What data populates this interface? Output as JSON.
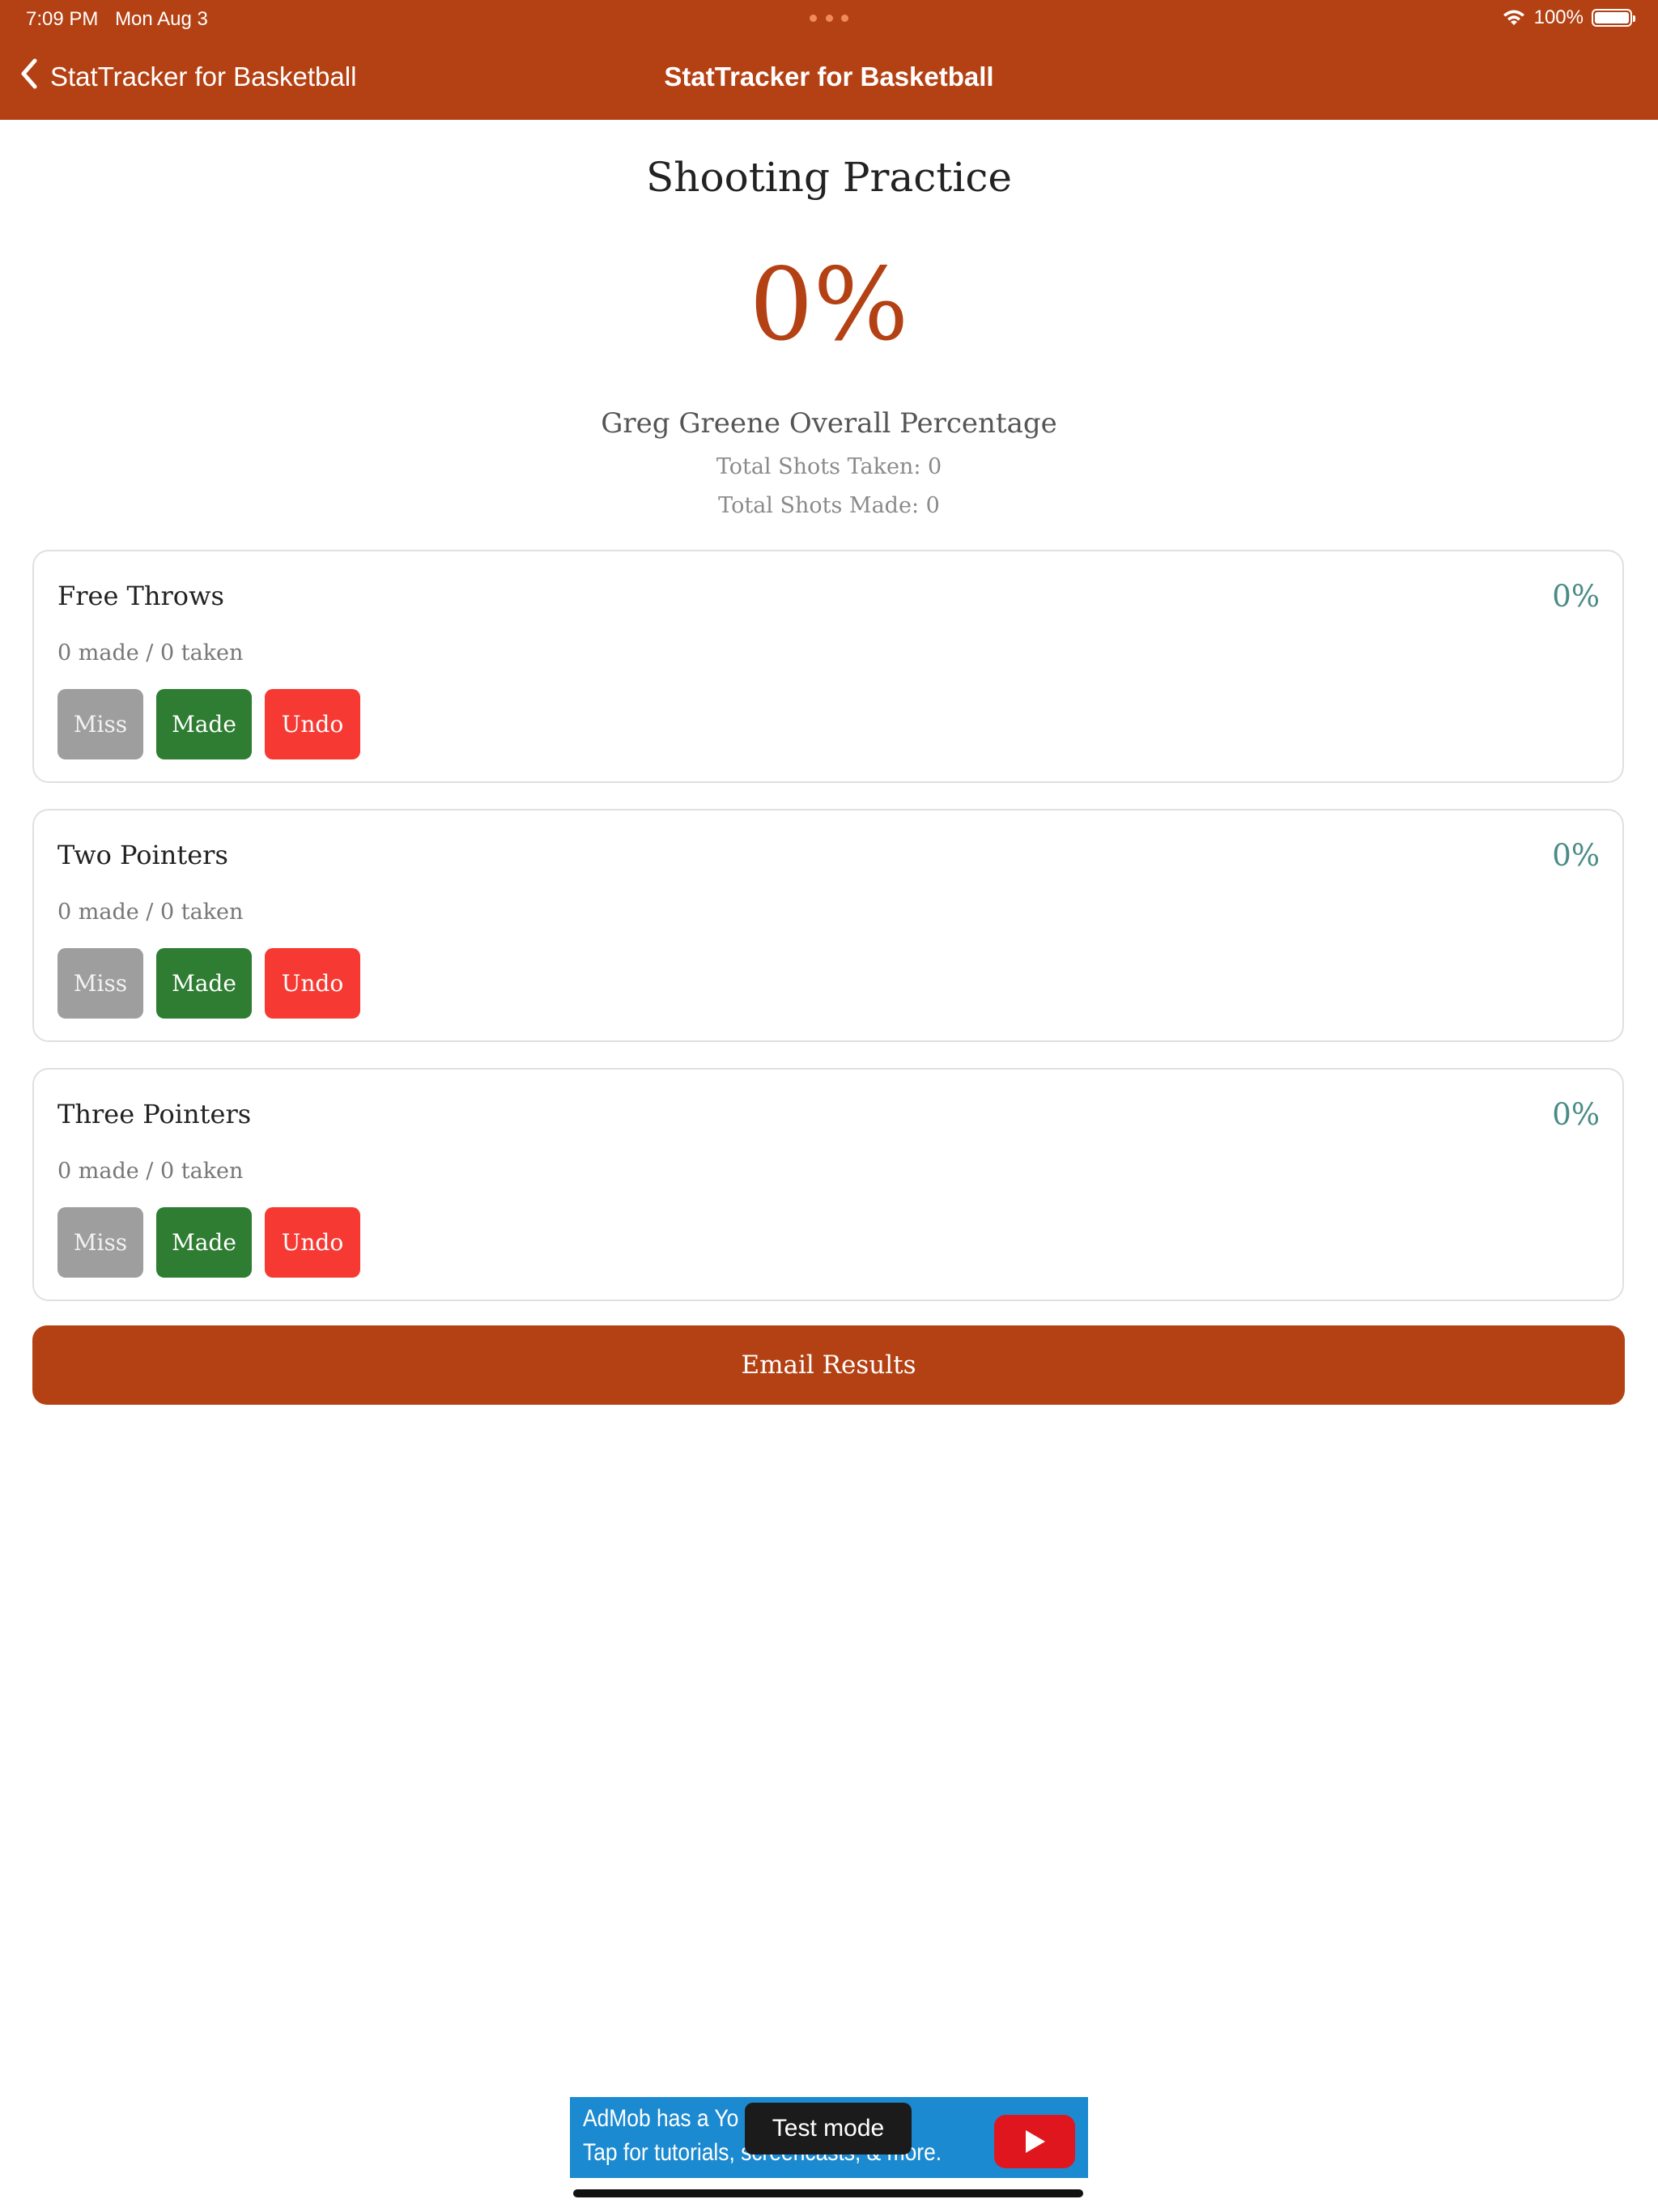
{
  "status_bar": {
    "time": "7:09 PM",
    "date": "Mon Aug 3",
    "battery": "100%"
  },
  "nav": {
    "back_label": "StatTracker for Basketball",
    "title": "StatTracker for Basketball"
  },
  "main": {
    "title": "Shooting Practice",
    "overall_percentage": "0%",
    "overall_label": "Greg Greene Overall Percentage",
    "total_taken": "Total Shots Taken: 0",
    "total_made": "Total Shots Made: 0"
  },
  "cards": [
    {
      "title": "Free Throws",
      "percentage": "0%",
      "summary": "0 made / 0 taken",
      "miss_label": "Miss",
      "made_label": "Made",
      "undo_label": "Undo"
    },
    {
      "title": "Two Pointers",
      "percentage": "0%",
      "summary": "0 made / 0 taken",
      "miss_label": "Miss",
      "made_label": "Made",
      "undo_label": "Undo"
    },
    {
      "title": "Three Pointers",
      "percentage": "0%",
      "summary": "0 made / 0 taken",
      "miss_label": "Miss",
      "made_label": "Made",
      "undo_label": "Undo"
    }
  ],
  "email_button": "Email Results",
  "ad": {
    "line1": "AdMob has a Yo",
    "line2": "Tap for tutorials, screencasts, & more.",
    "test_label": "Test mode"
  },
  "colors": {
    "accent": "#b44113",
    "made": "#2e7d32",
    "undo": "#f63a33",
    "miss": "#9e9e9e",
    "card_percentage": "#4a8b86"
  },
  "icons": {
    "back": "chevron-left-icon",
    "wifi": "wifi-icon",
    "battery": "battery-icon",
    "ad_play": "play-icon"
  }
}
